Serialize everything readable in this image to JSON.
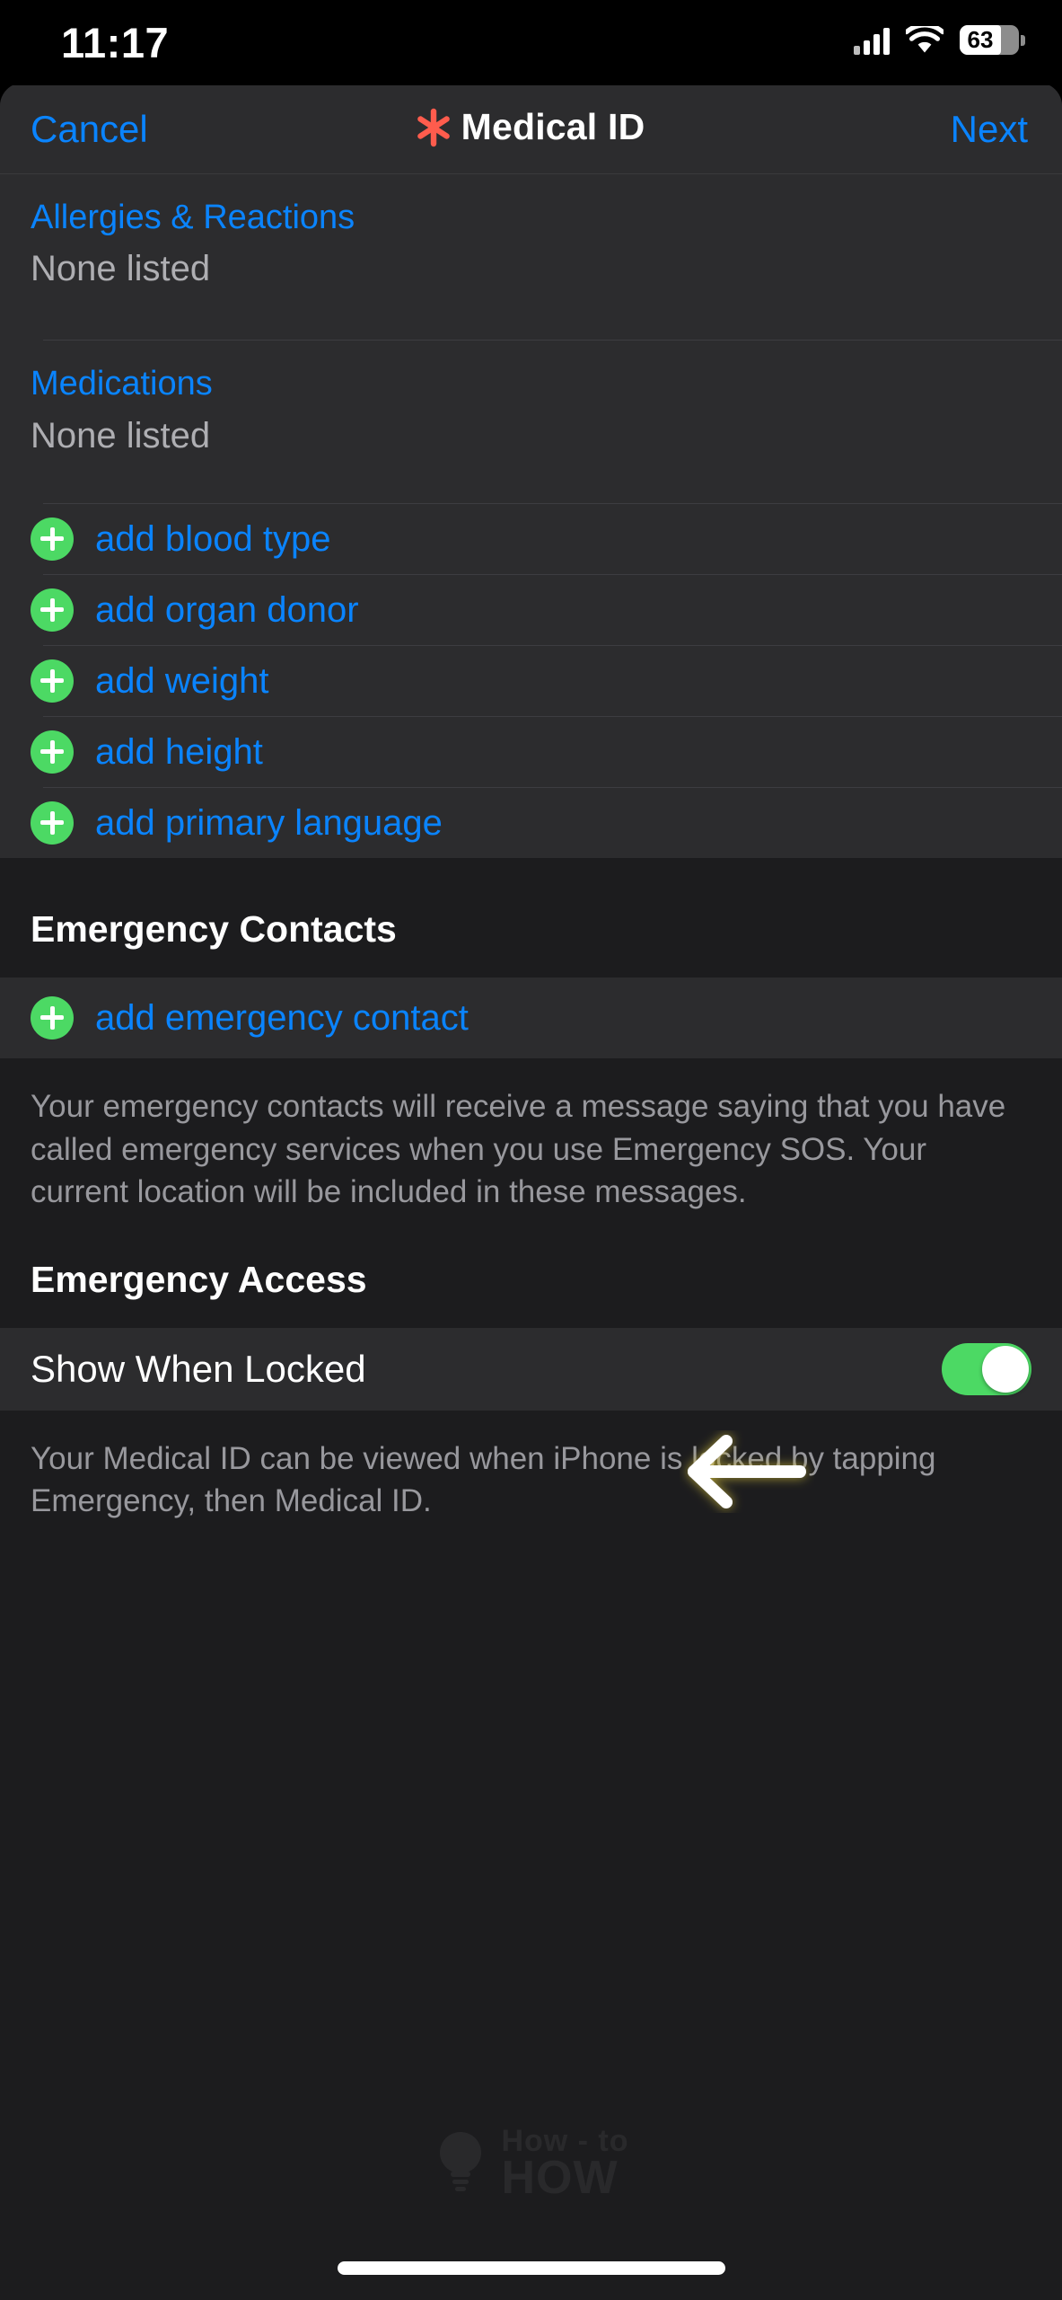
{
  "status_bar": {
    "time": "11:17",
    "battery_percent": "63",
    "cellular_icon": "cellular-bars-icon",
    "wifi_icon": "wifi-icon",
    "battery_icon": "battery-icon"
  },
  "nav": {
    "cancel_label": "Cancel",
    "title": "Medical ID",
    "next_label": "Next",
    "medical_icon": "medical-star-of-life-icon",
    "accent_blue": "#0a84ff",
    "medical_red": "#ff5c4d"
  },
  "fields": [
    {
      "title": "Allergies & Reactions",
      "value": "None listed"
    },
    {
      "title": "Medications",
      "value": "None listed"
    }
  ],
  "add_rows": [
    {
      "label": "add blood type",
      "icon": "plus-circle-icon"
    },
    {
      "label": "add organ donor",
      "icon": "plus-circle-icon"
    },
    {
      "label": "add weight",
      "icon": "plus-circle-icon"
    },
    {
      "label": "add height",
      "icon": "plus-circle-icon"
    },
    {
      "label": "add primary language",
      "icon": "plus-circle-icon"
    }
  ],
  "emergency_contacts": {
    "header": "Emergency Contacts",
    "add_label": "add emergency contact",
    "add_icon": "plus-circle-icon",
    "arrow_icon": "left-arrow-annotation-icon",
    "footnote": "Your emergency contacts will receive a message saying that you have called emergency services when you use Emergency SOS. Your current location will be included in these messages."
  },
  "emergency_access": {
    "header": "Emergency Access",
    "toggle_label": "Show When Locked",
    "toggle_state": "on",
    "toggle_on_color": "#4cd964",
    "footnote": "Your Medical ID can be viewed when iPhone is locked by tapping Emergency, then Medical ID."
  },
  "watermark": {
    "line1": "How - to",
    "line2": "HOW",
    "icon": "lightbulb-icon"
  },
  "colors": {
    "group_bg": "#2c2c2e",
    "page_bg": "#1c1c1e",
    "plus_green": "#4cd964"
  }
}
